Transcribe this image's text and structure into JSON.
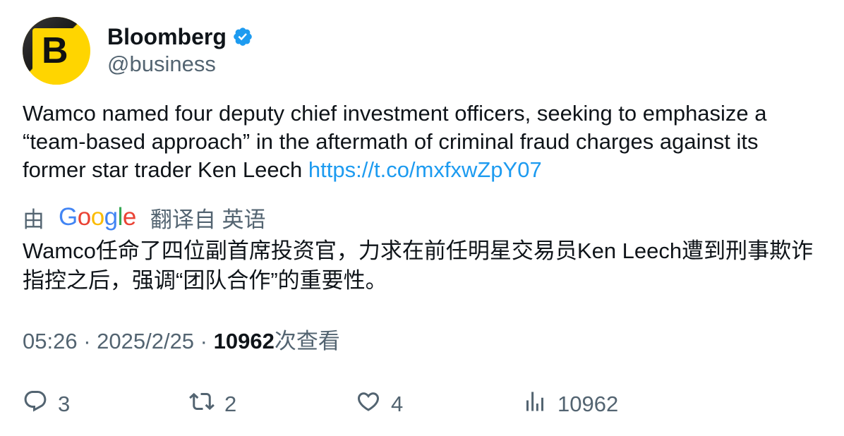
{
  "author": {
    "display_name": "Bloomberg",
    "handle": "@business",
    "avatar_letter": "B",
    "avatar_color": "#ffd500",
    "verified_icon": "verified-badge-icon",
    "verified_color": "#1d9bf0"
  },
  "tweet": {
    "text": "Wamco named four deputy chief investment officers, seeking to emphasize a “team-based approach” in the aftermath of criminal fraud charges against its former star trader Ken Leech ",
    "link": "https://t.co/mxfxwZpY07",
    "link_color": "#1d9bf0"
  },
  "translation": {
    "prefix": "由",
    "provider": "Google",
    "suffix": "翻译自 英语",
    "text": "Wamco任命了四位副首席投资官，力求在前任明星交易员Ken Leech遭到刑事欺诈指控之后，强调“团队合作”的重要性。"
  },
  "meta": {
    "time": "05:26",
    "separator": " · ",
    "date": "2025/2/25",
    "views_count": "10962",
    "views_label": "次查看"
  },
  "actions": {
    "reply": {
      "icon": "reply-icon",
      "count": "3"
    },
    "retweet": {
      "icon": "retweet-icon",
      "count": "2"
    },
    "like": {
      "icon": "heart-icon",
      "count": "4"
    },
    "views": {
      "icon": "views-chart-icon",
      "count": "10962"
    }
  },
  "colors": {
    "secondary_text": "#536471",
    "primary_text": "#0f1419",
    "google_blue": "#4285f4",
    "google_red": "#ea4335",
    "google_yellow": "#fbbc05",
    "google_green": "#34a853"
  }
}
